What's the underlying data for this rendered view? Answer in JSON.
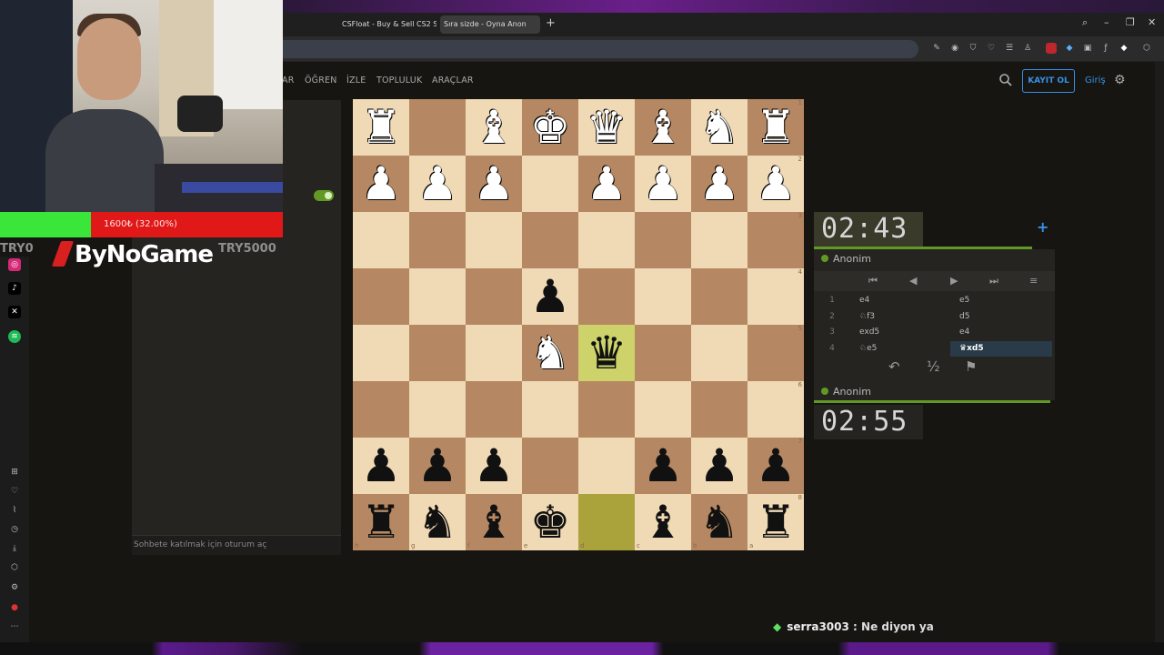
{
  "browser": {
    "tabs": [
      {
        "label": "CSFloat - Buy & Sell CS2 S"
      },
      {
        "label": "Sıra sizde - Oyna Anon"
      }
    ],
    "new_tab": "+",
    "window_controls": {
      "search": "⌕",
      "minimize": "–",
      "restore": "❐",
      "close": "✕"
    }
  },
  "header": {
    "nav": [
      "AR",
      "ÖĞREN",
      "İZLE",
      "TOPLULUK",
      "ARAÇLAR"
    ],
    "signup_label": "KAYIT OL",
    "login_label": "Giriş"
  },
  "stream": {
    "progress_text": "1600₺ (32.00%)",
    "progress_fraction": 0.32,
    "goal_start": "TRY0",
    "goal_end": "TRY5000",
    "brand": "ByNoGame"
  },
  "chat": {
    "input_placeholder": "Sohbete katılmak için oturum aç",
    "overlay_user": "serra3003",
    "overlay_sep": ":",
    "overlay_message": "Ne diyon ya"
  },
  "board": {
    "ranks": [
      "1",
      "2",
      "3",
      "4",
      "5",
      "6",
      "7",
      "8"
    ],
    "files": [
      "h",
      "g",
      "f",
      "e",
      "d",
      "c",
      "b",
      "a"
    ],
    "rows": [
      [
        "♜w",
        "",
        "♝w",
        "♚w",
        "♛w",
        "♝w",
        "♞w",
        "♜w"
      ],
      [
        "♟w",
        "♟w",
        "♟w",
        "",
        "♟w",
        "♟w",
        "♟w",
        "♟w"
      ],
      [
        "",
        "",
        "",
        "",
        "",
        "",
        "",
        ""
      ],
      [
        "",
        "",
        "",
        "♟b",
        "",
        "",
        "",
        ""
      ],
      [
        "",
        "",
        "",
        "♞w",
        "♛b",
        "",
        "",
        ""
      ],
      [
        "",
        "",
        "",
        "",
        "",
        "",
        "",
        ""
      ],
      [
        "♟b",
        "♟b",
        "♟b",
        "",
        "",
        "♟b",
        "♟b",
        "♟b"
      ],
      [
        "♜b",
        "♞b",
        "♝b",
        "♚b",
        "",
        "♝b",
        "♞b",
        "♜b"
      ]
    ],
    "highlights": [
      {
        "row": 4,
        "col": 4,
        "kind": "a"
      },
      {
        "row": 7,
        "col": 4,
        "kind": "b"
      }
    ]
  },
  "game": {
    "top_clock": {
      "minutes": "02",
      "seconds": "43"
    },
    "bottom_clock": {
      "minutes": "02",
      "seconds": "55"
    },
    "top_player": "Anonim",
    "bottom_player": "Anonim",
    "moves": [
      {
        "no": "1",
        "white": "e4",
        "black": "e5"
      },
      {
        "no": "2",
        "white": "♘f3",
        "black": "d5"
      },
      {
        "no": "3",
        "white": "exd5",
        "black": "e4"
      },
      {
        "no": "4",
        "white": "♘e5",
        "black": "♛xd5"
      }
    ],
    "active_move": "♛xd5",
    "controls": [
      "⏮",
      "◀",
      "▶",
      "⏭",
      "≡"
    ],
    "actions": [
      "↶",
      "½",
      "⚑"
    ]
  },
  "colors": {
    "board_light": "#f0d9b5",
    "board_dark": "#b58863",
    "accent": "#3692e7",
    "clock_bar": "#629924"
  }
}
